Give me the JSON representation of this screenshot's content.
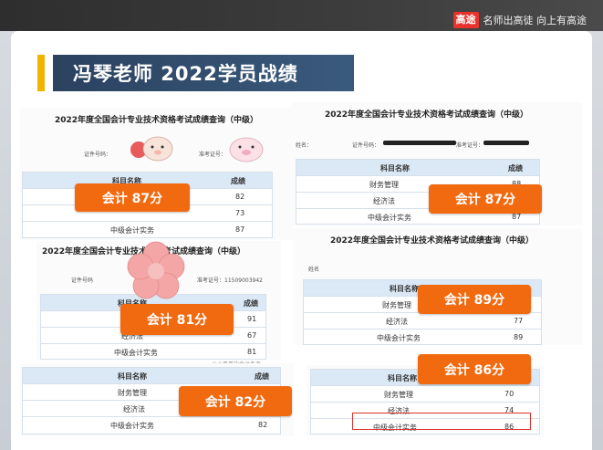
{
  "brand": {
    "logo": "高途",
    "slogan": "名师出高徒 向上有高途"
  },
  "title": "冯琴老师 2022学员战绩",
  "docs": {
    "d1": {
      "title": "2022年度全国会计专业技术资格考试成绩查询（中级）",
      "meta_id": "证件号码：",
      "meta_exam": "准考证号：",
      "head": {
        "subject": "科目名称",
        "score": "成绩"
      },
      "rows": [
        {
          "subject": "",
          "score": "82"
        },
        {
          "subject": "",
          "score": "73"
        },
        {
          "subject": "中级会计实务",
          "score": "87"
        }
      ]
    },
    "d2": {
      "title": "2022年度全国会计专业技术资格考试成绩查询（中级）",
      "meta_name": "姓名：",
      "meta_id": "证件号码：",
      "meta_exam": "准考证号：",
      "head": {
        "subject": "科目名称",
        "score": "成绩"
      },
      "rows": [
        {
          "subject": "财务管理",
          "score": "88"
        },
        {
          "subject": "经济法",
          "score": ""
        },
        {
          "subject": "中级会计实务",
          "score": "87"
        }
      ]
    },
    "d3": {
      "title": "2022年度全国会计专业技术资格考试成绩查询（中级）",
      "meta_id": "证件号码",
      "meta_exam": "准考证号：11509003942",
      "head": {
        "subject": "科目名称",
        "score": "成绩"
      },
      "rows": [
        {
          "subject": "",
          "score": "91"
        },
        {
          "subject": "经济法",
          "score": "67"
        },
        {
          "subject": "中级会计实务",
          "score": "81"
        }
      ],
      "watermark": "@小哥哥的会计备考"
    },
    "d4": {
      "title": "2022年度全国会计专业技术资格考试成绩查询（中级）",
      "meta_name": "姓名",
      "head": {
        "subject": "科目名称",
        "score": "成绩"
      },
      "rows": [
        {
          "subject": "财务管理",
          "score": ""
        },
        {
          "subject": "经济法",
          "score": "77"
        },
        {
          "subject": "中级会计实务",
          "score": "89"
        }
      ]
    },
    "d5": {
      "head": {
        "subject": "科目名称",
        "score": "成绩"
      },
      "rows": [
        {
          "subject": "财务管理",
          "score": "82"
        },
        {
          "subject": "经济法",
          "score": ""
        },
        {
          "subject": "中级会计实务",
          "score": "82"
        }
      ]
    },
    "d6": {
      "head": {
        "subject": "科目名称",
        "score": "成绩"
      },
      "rows": [
        {
          "subject": "财务管理",
          "score": "70"
        },
        {
          "subject": "经济法",
          "score": "74"
        },
        {
          "subject": "中级会计实务",
          "score": "86"
        }
      ]
    }
  },
  "badges": {
    "b1": "会计 87分",
    "b2": "会计 87分",
    "b3": "会计 81分",
    "b4": "会计 89分",
    "b5": "会计 82分",
    "b6": "会计 86分"
  },
  "colors": {
    "accent": "#f26a10",
    "title_bg": "#2b4260",
    "bar": "#f0b400",
    "brand": "#e8322b"
  }
}
